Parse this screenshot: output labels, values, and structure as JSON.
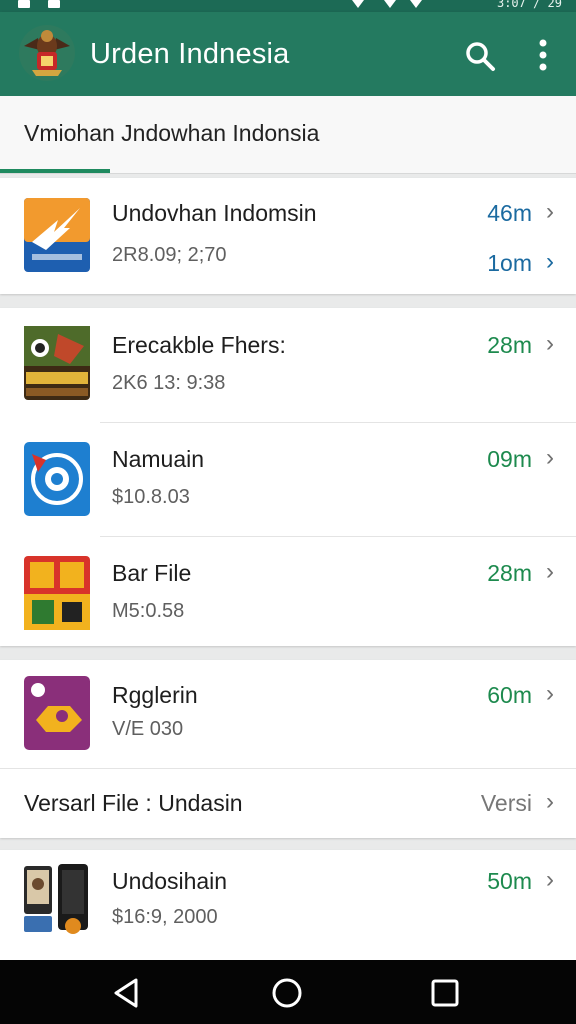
{
  "status_bar": {
    "time": "3:07 / 29"
  },
  "app_bar": {
    "title": "Urden Indnesia"
  },
  "tab": {
    "label": "Vmiohan Jndowhan Indonsia"
  },
  "items": [
    {
      "title": "Undovhan Indomsin",
      "sub": "2R8.09; 2;70",
      "meta": "46m",
      "meta2": "1om",
      "icon": "lightning-arrow-icon"
    },
    {
      "title": "Erecakble Fhers:",
      "sub": "2K6 13: 9:38",
      "meta": "28m",
      "icon": "game-artwork-icon"
    },
    {
      "title": "Namuain",
      "sub": "$10.8.03",
      "meta": "09m",
      "icon": "circle-target-icon"
    },
    {
      "title": "Bar File",
      "sub": "M5:0.58",
      "meta": "28m",
      "icon": "letter-tiles-icon"
    },
    {
      "title": "Rgglerin",
      "sub": "V/E 030",
      "meta": "60m",
      "icon": "purple-pin-icon"
    },
    {
      "title": "Versarl File : Undasin",
      "meta": "Versi"
    },
    {
      "title": "Undosihain",
      "sub": "$16:9, 2000",
      "meta": "50m",
      "icon": "phones-icon"
    }
  ],
  "colors": {
    "accent": "#247a60",
    "meta_green": "#1d8a4e",
    "meta_blue": "#1b6aa0"
  }
}
